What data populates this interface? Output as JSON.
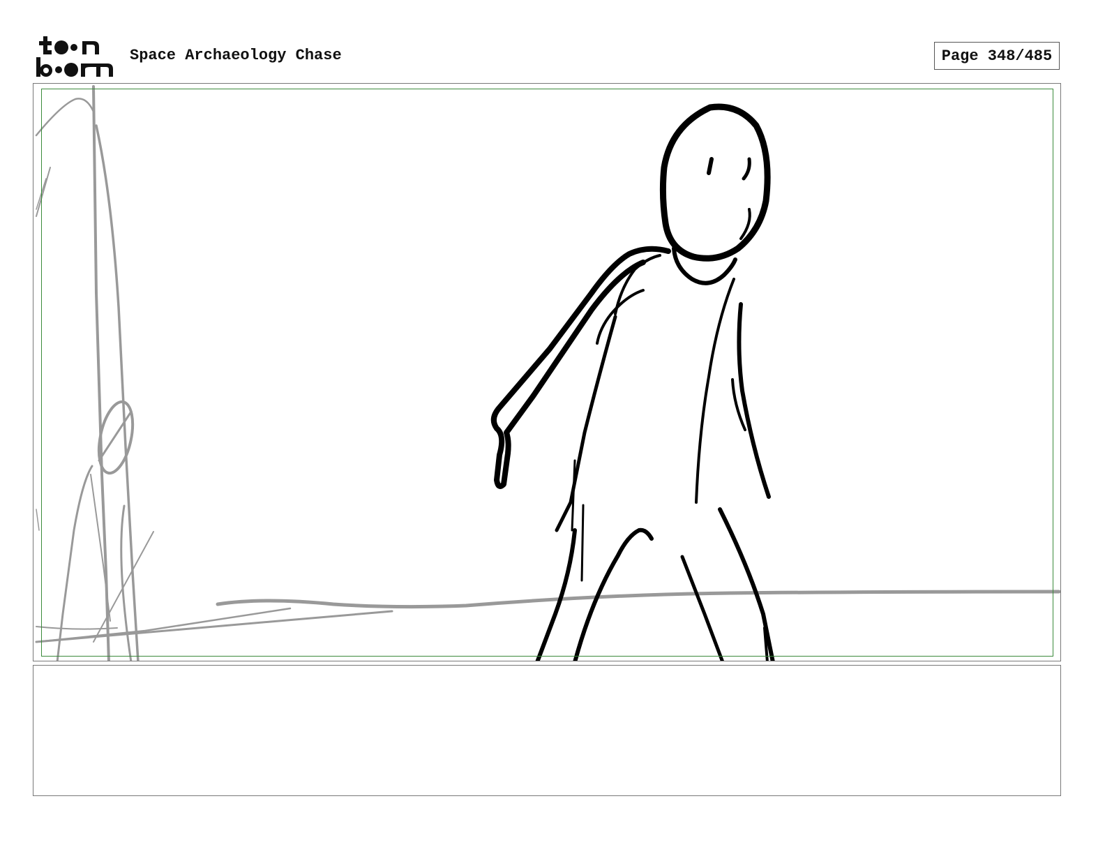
{
  "header": {
    "logo": {
      "line1": "toon",
      "line2": "boom",
      "icon": "toon-boom-logo"
    },
    "project_title": "Space Archaeology Chase",
    "page_label": "Page 348/485"
  },
  "panel": {
    "sketch": {
      "description_icons": [
        "stick-figure-sketch",
        "background-pillar-sketch",
        "horizon-line-sketch"
      ]
    }
  },
  "notes": {
    "text": ""
  }
}
